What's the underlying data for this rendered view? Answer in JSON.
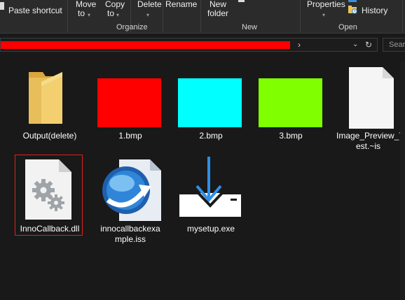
{
  "ribbon": {
    "paste_shortcut": "Paste shortcut",
    "move": "Move",
    "move_to": "to",
    "copy": "Copy",
    "copy_to": "to",
    "delete": "Delete",
    "rename": "Rename",
    "new": "New",
    "folder": "folder",
    "properties": "Properties",
    "history": "History",
    "groups": {
      "organize": "Organize",
      "new": "New",
      "open": "Open"
    }
  },
  "address": {
    "search_placeholder": "Sear"
  },
  "files": [
    {
      "name": "Output(delete)",
      "type": "folder"
    },
    {
      "name": "1.bmp",
      "type": "image",
      "color": "#ff0000"
    },
    {
      "name": "2.bmp",
      "type": "image",
      "color": "#00ffff"
    },
    {
      "name": "3.bmp",
      "type": "image",
      "color": "#80ff00"
    },
    {
      "name": "Image_Preview_Test.~is",
      "name_lines": [
        "Image_Preview_T",
        "est.~is"
      ],
      "type": "file"
    },
    {
      "name": "InnoCallback.dll",
      "type": "dll",
      "selected": true
    },
    {
      "name": "innocallbackexample.iss",
      "name_lines": [
        "innocallbackexa",
        "mple.iss"
      ],
      "type": "inno-script"
    },
    {
      "name": "mysetup.exe",
      "type": "installer"
    }
  ],
  "colors": {
    "background": "#191919",
    "ribbon": "#2b2b2b",
    "selection": "#e02020",
    "address_highlight": "#ff0000"
  }
}
